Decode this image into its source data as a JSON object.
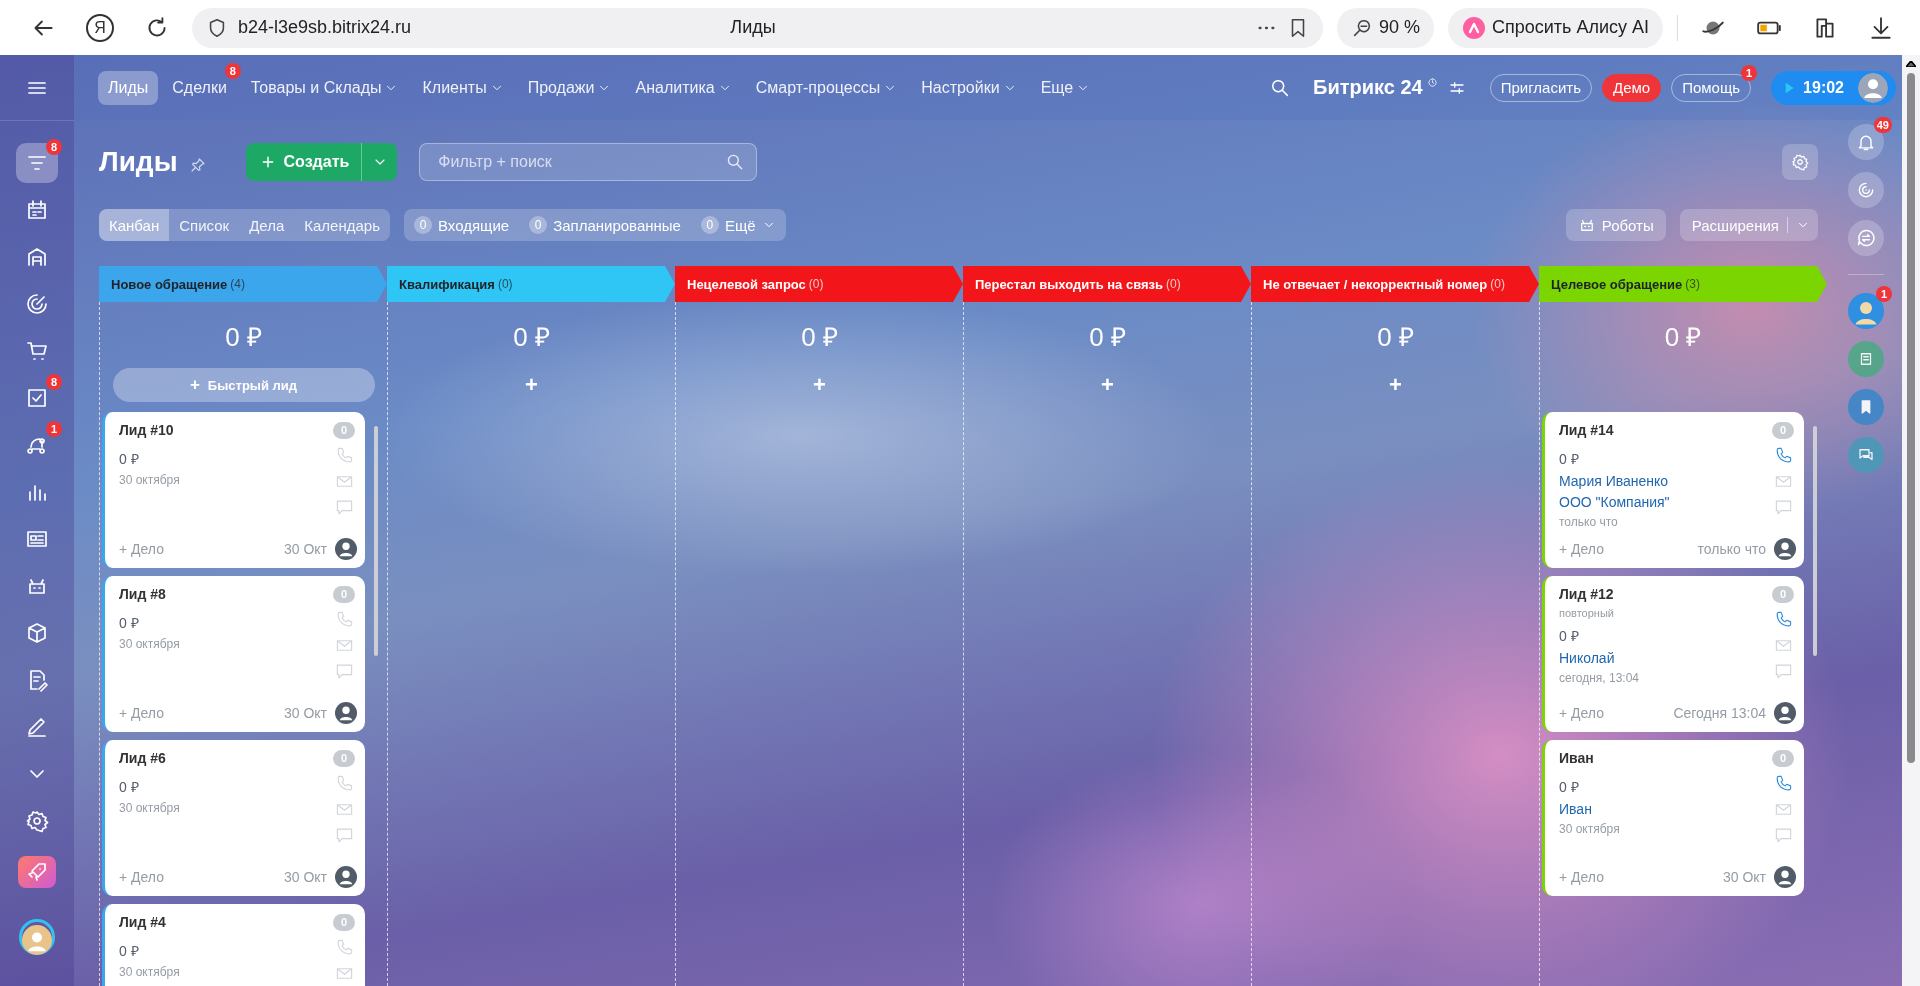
{
  "browser": {
    "logo": "Я",
    "url": "b24-l3e9sb.bitrix24.ru",
    "title": "Лиды",
    "zoom": "90 %",
    "assistant": "Спросить Алису AI"
  },
  "sidebar": {
    "items": [
      {
        "kind": "nav",
        "selected": true,
        "badge": "8"
      },
      {
        "kind": "nav",
        "selected": false
      },
      {
        "kind": "nav",
        "selected": false
      },
      {
        "kind": "nav",
        "selected": false
      },
      {
        "kind": "nav",
        "selected": false
      },
      {
        "kind": "nav",
        "selected": false,
        "badge": "8"
      },
      {
        "kind": "nav",
        "selected": false,
        "badge": "1"
      },
      {
        "kind": "nav",
        "selected": false
      },
      {
        "kind": "nav",
        "selected": false
      },
      {
        "kind": "nav",
        "selected": false
      },
      {
        "kind": "nav",
        "selected": false
      },
      {
        "kind": "nav",
        "selected": false
      },
      {
        "kind": "nav",
        "selected": false
      },
      {
        "kind": "nav",
        "selected": false
      },
      {
        "kind": "nav",
        "selected": false
      },
      {
        "kind": "app",
        "selected": false
      },
      {
        "kind": "profile",
        "selected": false
      }
    ]
  },
  "topnav": {
    "items": [
      {
        "label": "Лиды",
        "selected": true,
        "dropdown": false
      },
      {
        "label": "Сделки",
        "selected": false,
        "dropdown": false,
        "badge": "8"
      },
      {
        "label": "Товары и Склады",
        "selected": false,
        "dropdown": true
      },
      {
        "label": "Клиенты",
        "selected": false,
        "dropdown": true
      },
      {
        "label": "Продажи",
        "selected": false,
        "dropdown": true
      },
      {
        "label": "Аналитика",
        "selected": false,
        "dropdown": true
      },
      {
        "label": "Смарт-процессы",
        "selected": false,
        "dropdown": true
      },
      {
        "label": "Настройки",
        "selected": false,
        "dropdown": true
      },
      {
        "label": "Еще",
        "selected": false,
        "dropdown": true
      }
    ],
    "brand": "Битрикс 24",
    "invite": "Пригласить",
    "demo": "Демо",
    "help": {
      "label": "Помощь",
      "badge": "1"
    },
    "timer": "19:02"
  },
  "page": {
    "title": "Лиды",
    "create": "Создать",
    "search": {
      "placeholder": "Фильтр + поиск"
    }
  },
  "views": [
    {
      "label": "Канбан",
      "selected": true
    },
    {
      "label": "Список",
      "selected": false
    },
    {
      "label": "Дела",
      "selected": false
    },
    {
      "label": "Календарь",
      "selected": false
    }
  ],
  "counters": [
    {
      "count": "0",
      "label": "Входящие",
      "dropdown": false
    },
    {
      "count": "0",
      "label": "Запланированные",
      "dropdown": false
    },
    {
      "count": "0",
      "label": "Ещё",
      "dropdown": true
    }
  ],
  "robots": "Роботы",
  "extensions": "Расширения",
  "rail": {
    "items": [
      {
        "kind": "bell",
        "badge": "49"
      },
      {
        "kind": "swirl"
      },
      {
        "kind": "chat"
      },
      {
        "kind": "avatar",
        "badge": "1"
      },
      {
        "kind": "notes"
      },
      {
        "kind": "bookmark"
      },
      {
        "kind": "messages"
      }
    ]
  },
  "columns": [
    {
      "name": "Новое обращение",
      "count": "(4)",
      "color": "#3ba6ec",
      "sum": "0 ₽",
      "add": {
        "icon": "+",
        "label": "Быстрый лид"
      },
      "cards": [
        {
          "title": "Лид #10",
          "amount": "0 ₽",
          "date": "30 октября",
          "counter": "0",
          "phone_active": false,
          "task": "+ Дело",
          "time": "30 Окт"
        },
        {
          "title": "Лид #8",
          "amount": "0 ₽",
          "date": "30 октября",
          "counter": "0",
          "phone_active": false,
          "task": "+ Дело",
          "time": "30 Окт"
        },
        {
          "title": "Лид #6",
          "amount": "0 ₽",
          "date": "30 октября",
          "counter": "0",
          "phone_active": false,
          "task": "+ Дело",
          "time": "30 Окт"
        },
        {
          "title": "Лид #4",
          "amount": "0 ₽",
          "date": "30 октября",
          "counter": "0",
          "phone_active": false
        }
      ]
    },
    {
      "name": "Квалификация",
      "count": "(0)",
      "color": "#2fc6f6",
      "sum": "0 ₽",
      "add": {
        "icon": "+"
      }
    },
    {
      "name": "Нецелевой запрос",
      "count": "(0)",
      "color": "#f2161a",
      "sum": "0 ₽",
      "add": {
        "icon": "+"
      }
    },
    {
      "name": "Перестал выходить на связь",
      "count": "(0)",
      "color": "#f2161a",
      "sum": "0 ₽",
      "add": {
        "icon": "+"
      }
    },
    {
      "name": "Не отвечает / некорректный номер",
      "count": "(0)",
      "color": "#f2161a",
      "sum": "0 ₽",
      "add": {
        "icon": "+"
      }
    },
    {
      "name": "Целевое обращение",
      "count": "(3)",
      "color": "#7bd500",
      "sum": "0 ₽",
      "cards": [
        {
          "title": "Лид #14",
          "amount": "0 ₽",
          "contacts": [
            "Мария Иваненко",
            "ООО \"Компания\""
          ],
          "date": "только что",
          "counter": "0",
          "phone_active": true,
          "task": "+ Дело",
          "time": "только что"
        },
        {
          "title": "Лид #12",
          "subtitle": "повторный",
          "amount": "0 ₽",
          "contacts": [
            "Николай"
          ],
          "date": "сегодня, 13:04",
          "counter": "0",
          "phone_active": true,
          "task": "+ Дело",
          "time": "Сегодня 13:04"
        },
        {
          "title": "Иван",
          "amount": "0 ₽",
          "contacts": [
            "Иван"
          ],
          "date": "30 октября",
          "counter": "0",
          "phone_active": true,
          "task": "+ Дело",
          "time": "30 Окт"
        }
      ]
    }
  ]
}
